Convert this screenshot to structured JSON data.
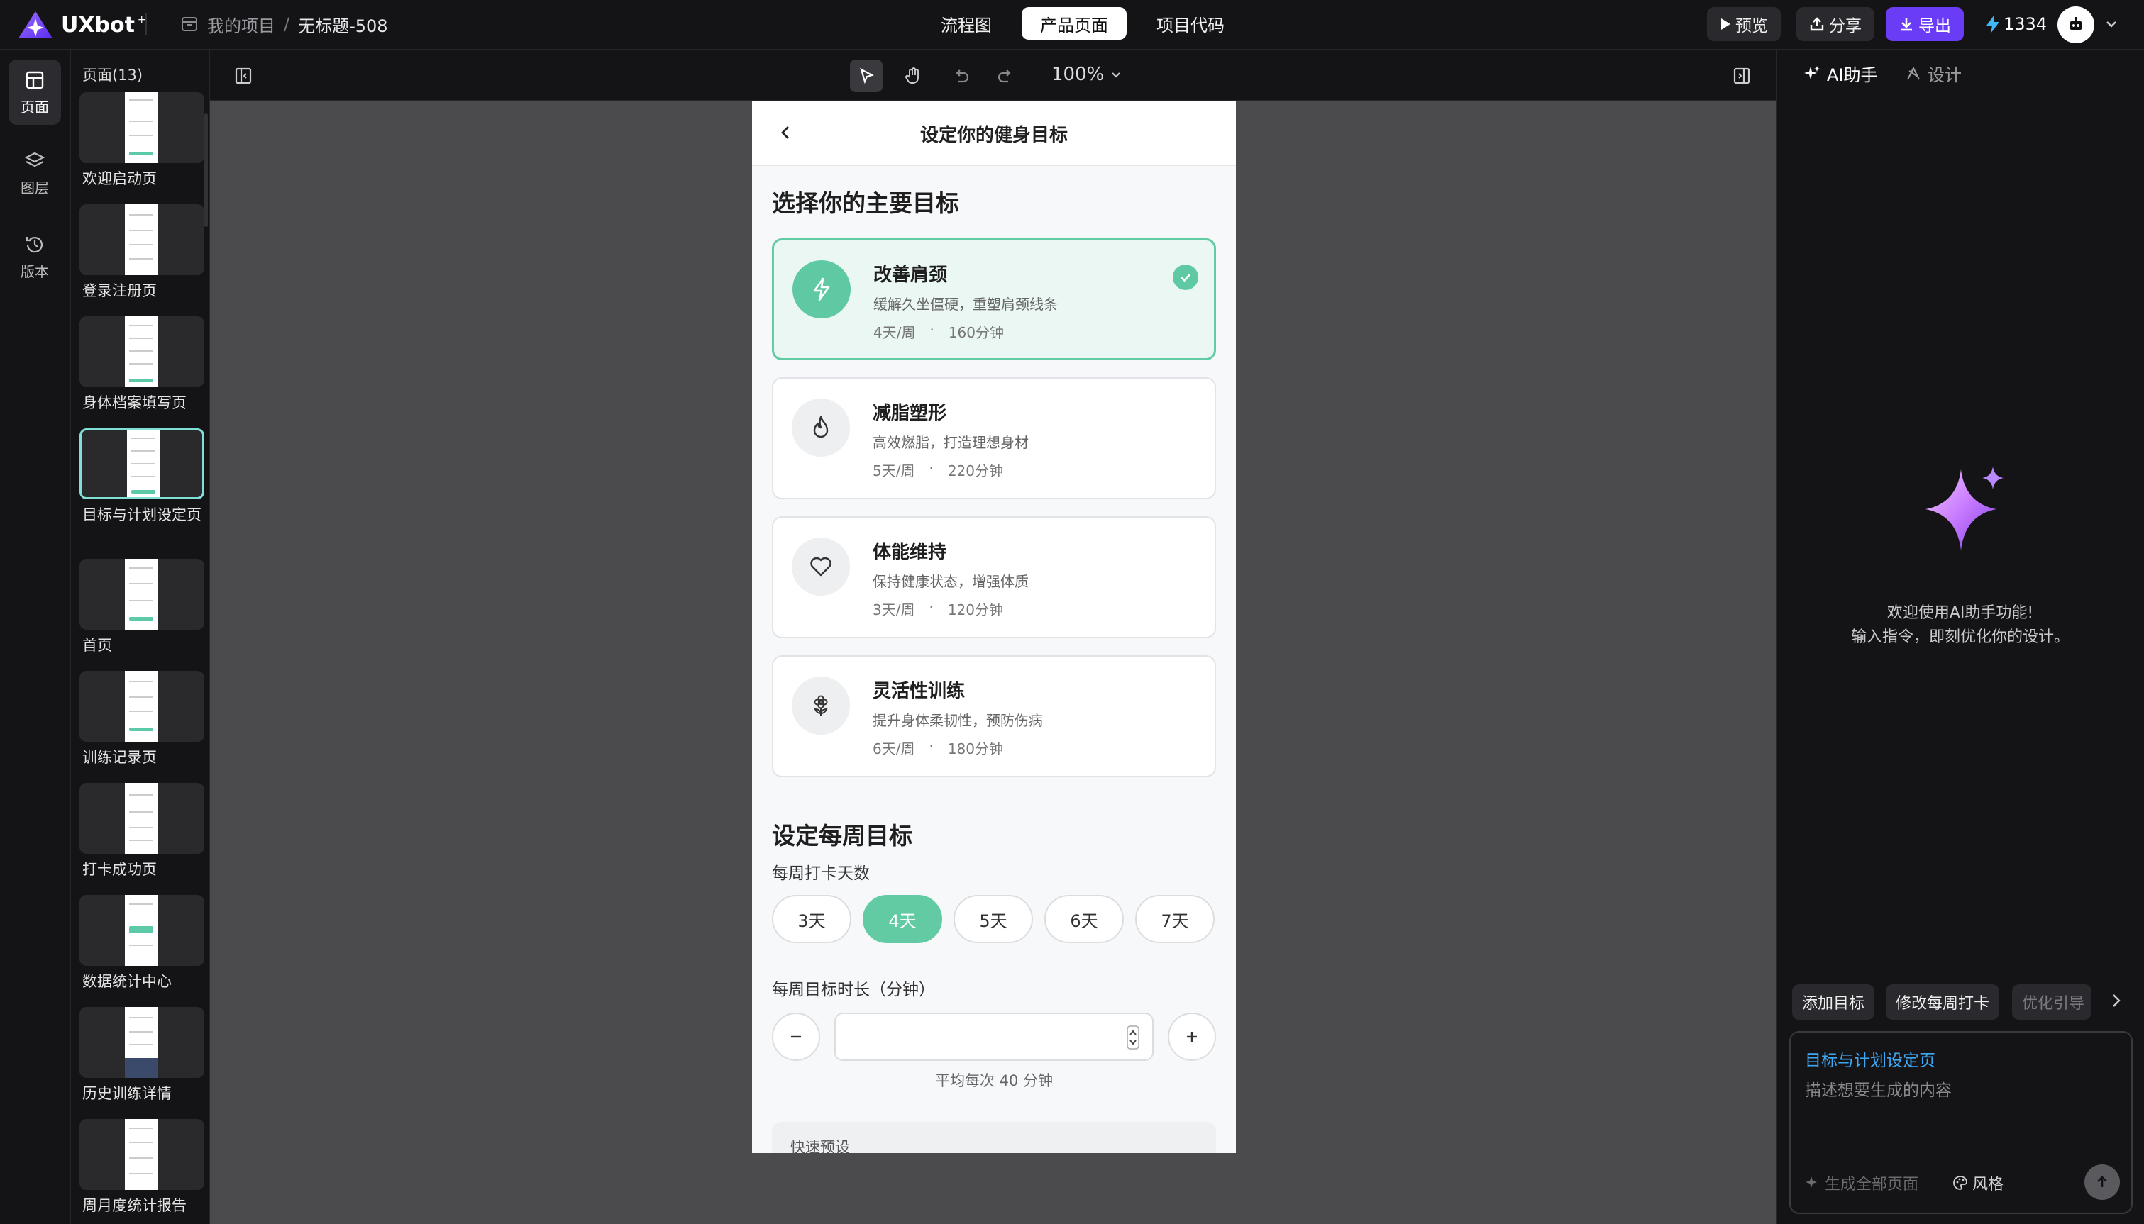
{
  "app": {
    "logo_text": "UXbot",
    "logo_sup": "+",
    "breadcrumb": {
      "project": "我的项目",
      "separator": "/",
      "current": "无标题-508"
    }
  },
  "header": {
    "tabs": [
      {
        "label": "流程图",
        "active": false
      },
      {
        "label": "产品页面",
        "active": true
      },
      {
        "label": "项目代码",
        "active": false
      }
    ],
    "preview_label": "预览",
    "share_label": "分享",
    "export_label": "导出",
    "credits": "1334",
    "accent_color": "#6b3cf5"
  },
  "rail": {
    "items": [
      {
        "label": "页面",
        "icon": "pages-icon",
        "active": true
      },
      {
        "label": "图层",
        "icon": "layers-icon",
        "active": false
      },
      {
        "label": "版本",
        "icon": "history-icon",
        "active": false
      }
    ]
  },
  "pages_panel": {
    "title": "页面(13)",
    "items": [
      {
        "label": "欢迎启动页",
        "active": false
      },
      {
        "label": "登录注册页",
        "active": false
      },
      {
        "label": "身体档案填写页",
        "active": false
      },
      {
        "label": "目标与计划设定页",
        "active": true
      },
      {
        "label": "首页",
        "active": false
      },
      {
        "label": "训练记录页",
        "active": false
      },
      {
        "label": "打卡成功页",
        "active": false
      },
      {
        "label": "数据统计中心",
        "active": false
      },
      {
        "label": "历史训练详情",
        "active": false
      },
      {
        "label": "周月度统计报告",
        "active": false
      }
    ]
  },
  "canvas": {
    "zoom": "100%"
  },
  "phone": {
    "title": "设定你的健身目标",
    "section1": "选择你的主要目标",
    "goals": [
      {
        "name": "改善肩颈",
        "desc": "缓解久坐僵硬，重塑肩颈线条",
        "days": "4天/周",
        "dot": "·",
        "minutes": "160分钟",
        "icon": "lightning-icon",
        "selected": true
      },
      {
        "name": "减脂塑形",
        "desc": "高效燃脂，打造理想身材",
        "days": "5天/周",
        "dot": "·",
        "minutes": "220分钟",
        "icon": "flame-icon",
        "selected": false
      },
      {
        "name": "体能维持",
        "desc": "保持健康状态，增强体质",
        "days": "3天/周",
        "dot": "·",
        "minutes": "120分钟",
        "icon": "heart-icon",
        "selected": false
      },
      {
        "name": "灵活性训练",
        "desc": "提升身体柔韧性，预防伤病",
        "days": "6天/周",
        "dot": "·",
        "minutes": "180分钟",
        "icon": "flower-icon",
        "selected": false
      }
    ],
    "section2": "设定每周目标",
    "days_label": "每周打卡天数",
    "day_options": [
      {
        "label": "3天",
        "active": false
      },
      {
        "label": "4天",
        "active": true
      },
      {
        "label": "5天",
        "active": false
      },
      {
        "label": "6天",
        "active": false
      },
      {
        "label": "7天",
        "active": false
      }
    ],
    "duration_label": "每周目标时长（分钟）",
    "duration_value": "",
    "avg_text": "平均每次 40 分钟",
    "quick_label": "快速预设",
    "accent_color": "#63cba4"
  },
  "right_panel": {
    "tabs": [
      {
        "label": "AI助手",
        "active": true
      },
      {
        "label": "设计",
        "active": false
      }
    ],
    "welcome_line1": "欢迎使用AI助手功能!",
    "welcome_line2": "输入指令，即刻优化你的设计。",
    "chips": [
      "添加目标",
      "修改每周打卡",
      "优化引导"
    ],
    "prompt_tag": "目标与计划设定页",
    "prompt_placeholder": "描述想要生成的内容",
    "generate_all": "生成全部页面",
    "style_label": "风格"
  }
}
